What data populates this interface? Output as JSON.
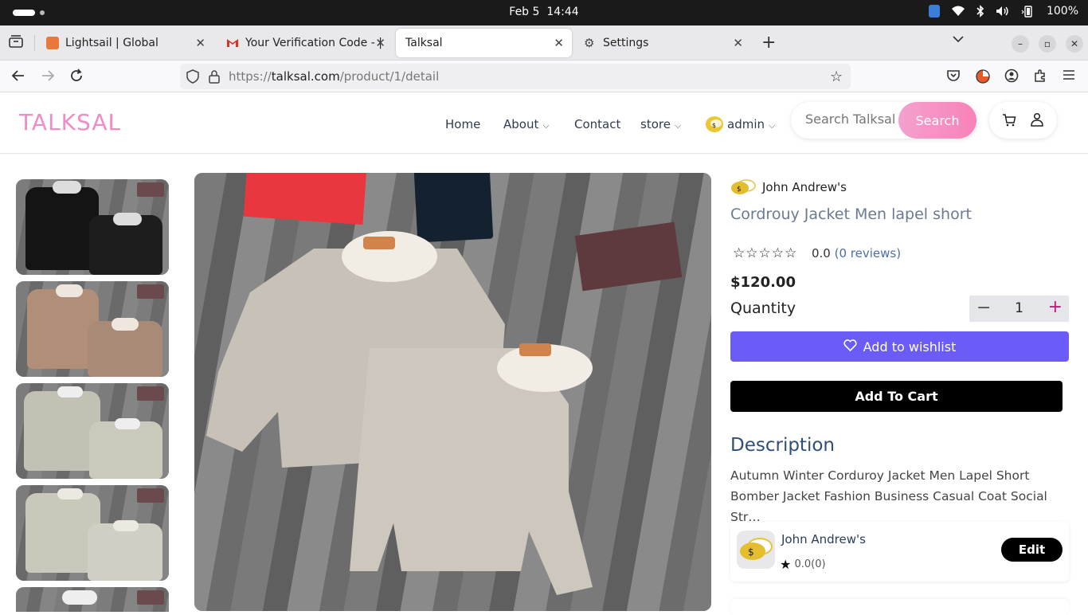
{
  "os": {
    "date": "Feb 5",
    "time": "14:44",
    "battery": "100%"
  },
  "browser": {
    "tabs": [
      {
        "label": "Lightsail | Global",
        "color": "#e8793a"
      },
      {
        "label": "Your Verification Code - |",
        "color": "#d93025"
      },
      {
        "label": "Talksal",
        "color": "#ffffff"
      },
      {
        "label": "Settings",
        "color": "#555555"
      }
    ],
    "url_prefix": "https://",
    "url_domain": "talksal.com",
    "url_path": "/product/1/detail"
  },
  "site": {
    "logo": "TALKSAL",
    "menu": {
      "home": "Home",
      "about": "About",
      "contact": "Contact",
      "store": "store",
      "admin": "admin"
    },
    "search": {
      "placeholder": "Search Talksal",
      "button": "Search"
    },
    "brand_color": "#f08bc5"
  },
  "product": {
    "seller": "John Andrew's",
    "title": "Cordrouy Jacket Men lapel short",
    "stars": "☆☆☆☆☆",
    "rating": "0.0",
    "reviews": "(0 reviews)",
    "price": "$120.00",
    "quantity_label": "Quantity",
    "quantity": "1",
    "wishlist_label": "Add to wishlist",
    "cart_label": "Add To Cart",
    "description_heading": "Description",
    "description": "Autumn Winter Corduroy Jacket Men Lapel Short Bomber Jacket Fashion Business Casual Coat Social Str…"
  },
  "seller_card": {
    "name": "John Andrew's",
    "rating": "0.0(0)",
    "edit_label": "Edit"
  }
}
